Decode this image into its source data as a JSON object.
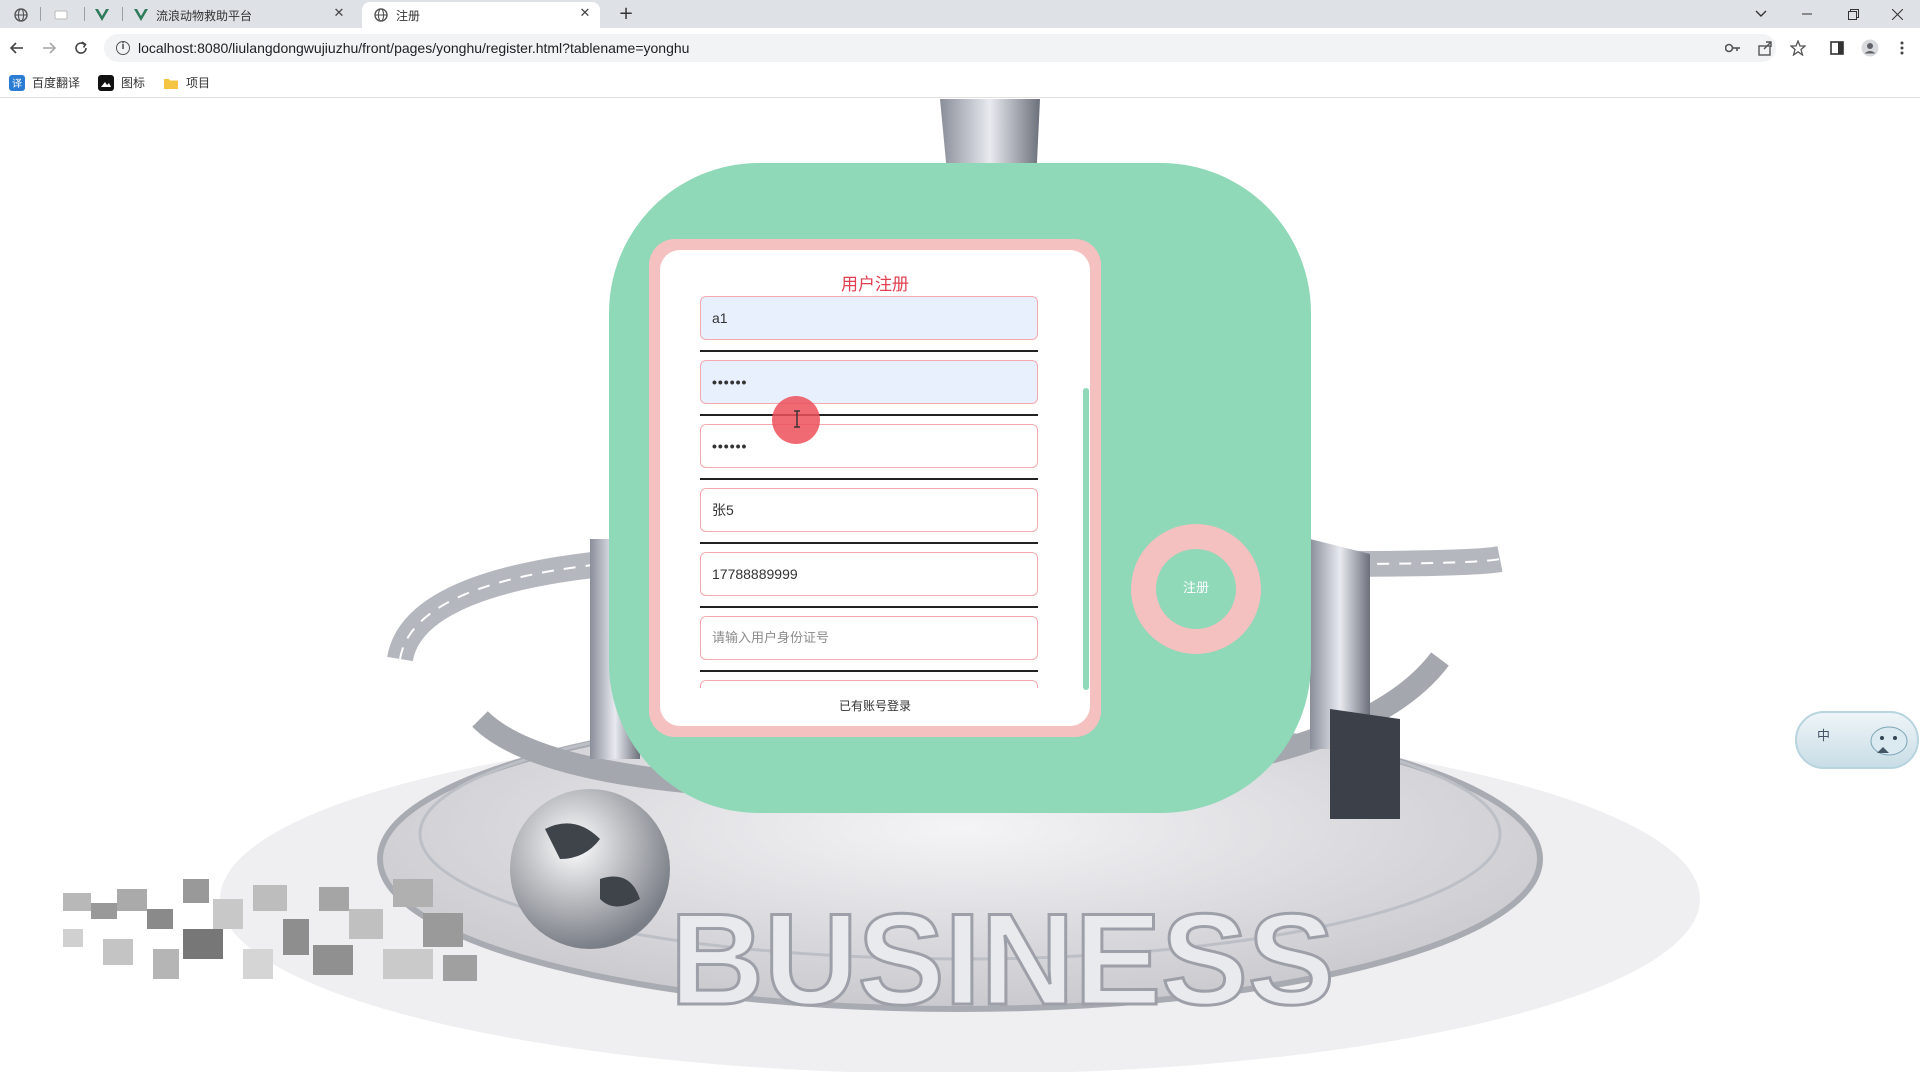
{
  "browser": {
    "tabs": [
      {
        "title": "",
        "icon": "globe-icon"
      },
      {
        "title": "",
        "icon": "blank-page-icon"
      },
      {
        "title": "",
        "icon": "vue-icon"
      },
      {
        "title": "流浪动物救助平台",
        "icon": "vue-icon"
      },
      {
        "title": "注册",
        "icon": "globe-icon",
        "active": true
      }
    ],
    "url": "localhost:8080/liulangdongwujiuzhu/front/pages/yonghu/register.html?tablename=yonghu",
    "bookmarks": [
      {
        "label": "百度翻译",
        "icon": "translate-icon"
      },
      {
        "label": "图标",
        "icon": "image-icon"
      },
      {
        "label": "项目",
        "icon": "folder-icon"
      }
    ]
  },
  "form": {
    "title": "用户注册",
    "fields": [
      {
        "name": "username",
        "value": "a1",
        "autofill": true
      },
      {
        "name": "password",
        "value": "••••••",
        "autofill": true
      },
      {
        "name": "password-confirm",
        "value": "••••••"
      },
      {
        "name": "real-name",
        "value": "张5"
      },
      {
        "name": "phone",
        "value": "17788889999"
      },
      {
        "name": "id-card",
        "value": "",
        "placeholder": "请输入用户身份证号"
      }
    ],
    "register_label": "注册",
    "login_link": "已有账号登录"
  },
  "ime": {
    "label": "中"
  },
  "colors": {
    "card_green": "#8fd8b8",
    "panel_pink": "#f5c0c0",
    "title_red": "#e04050",
    "field_border": "#f3a9ad",
    "autofill_blue": "#e8f0fe"
  }
}
